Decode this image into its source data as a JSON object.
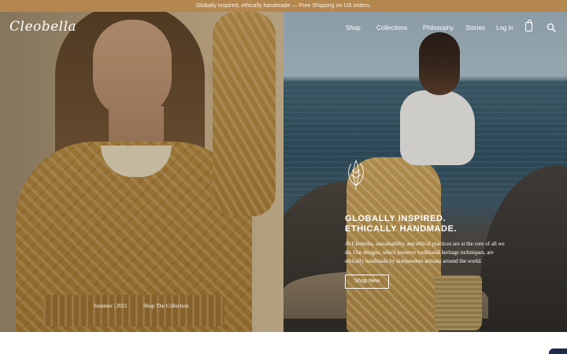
{
  "announcement": "Globally inspired, ethically handmade — Free Shipping on US orders.",
  "brand": {
    "logo_text": "Cleobella"
  },
  "nav": {
    "items": [
      "Shop",
      "Collections",
      "Philosophy",
      "Stories",
      "Log in"
    ],
    "icons": [
      "bag-icon",
      "search-icon"
    ]
  },
  "hero_left": {
    "season": "Summer | 2021",
    "link": "Shop The Collection"
  },
  "hero_right": {
    "headline_line1": "GLOBALLY INSPIRED.",
    "headline_line2": "ETHICALLY HANDMADE.",
    "body": "At Cleobella, sustainability and ethical practices are at the core of all we do. Our designs, which preserve traditional heritage techniques, are ethically handmade by independent artisans around the world.",
    "button": "Shop New"
  },
  "colors": {
    "announcement_bg": "#b4874f",
    "text_on_image": "#ffffff",
    "chat_tab": "#1c2a4a"
  }
}
